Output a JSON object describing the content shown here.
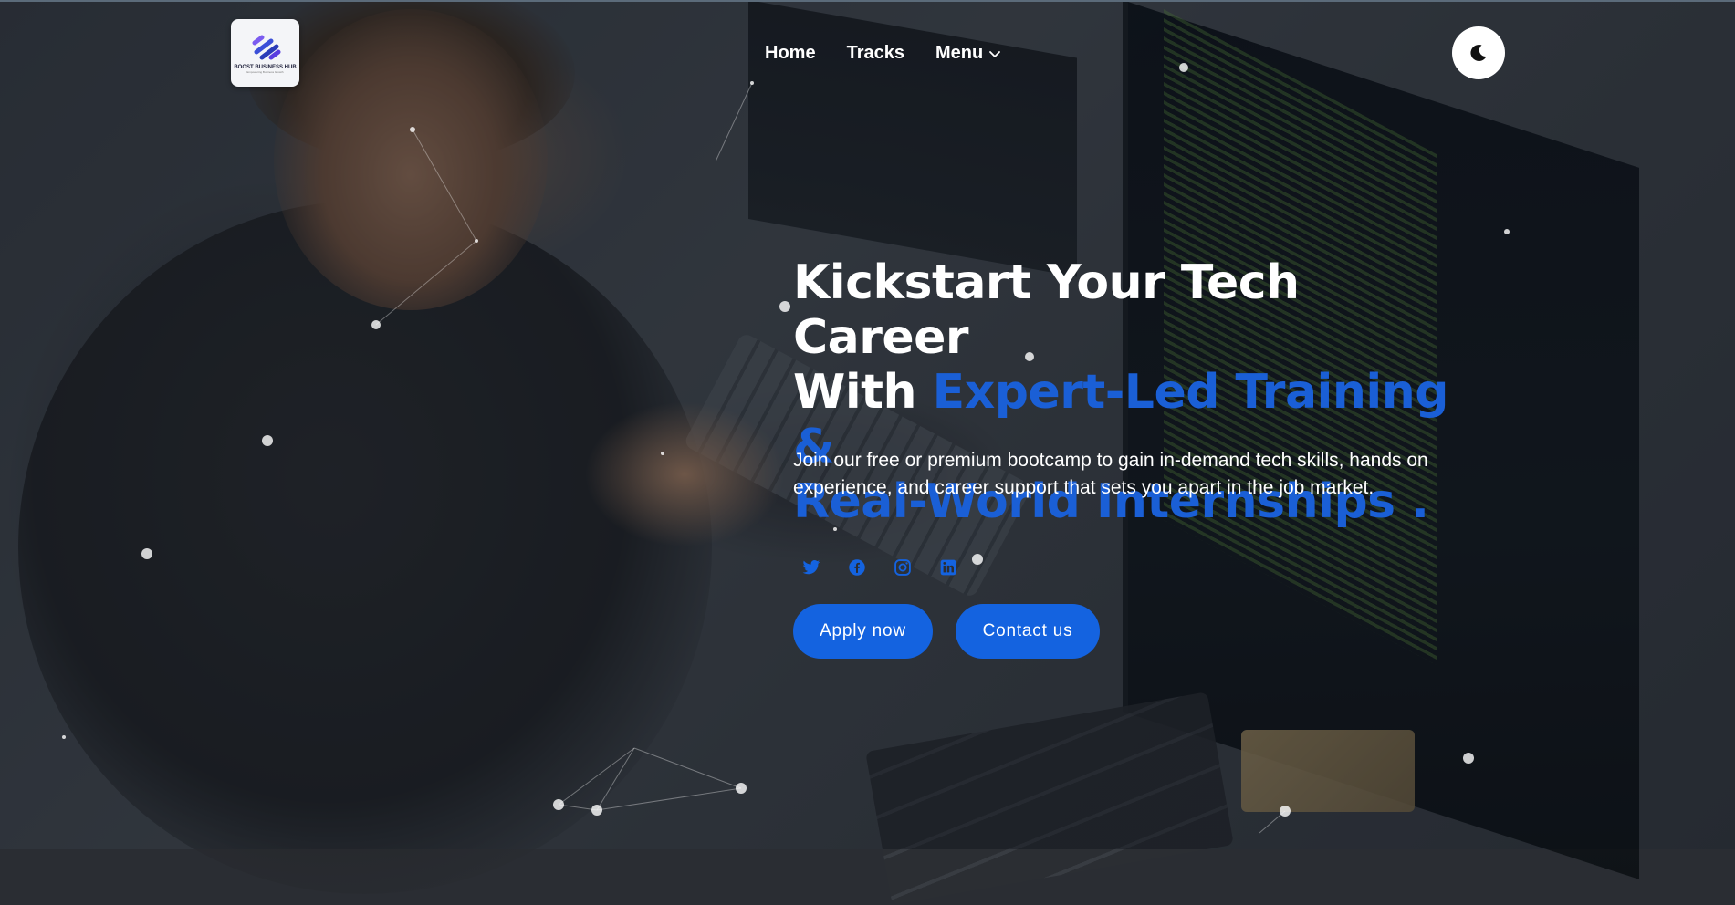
{
  "header": {
    "logo": {
      "name": "BOOST BUSINESS HUB",
      "tagline": "Empowering Business Growth"
    },
    "nav": [
      {
        "label": "Home"
      },
      {
        "label": "Tracks"
      },
      {
        "label": "Menu",
        "icon": "chevron-down-icon"
      }
    ],
    "theme_toggle": {
      "icon": "moon-icon"
    }
  },
  "hero": {
    "title_line1": "Kickstart Your Tech Career",
    "title_line2_prefix": "With ",
    "title_highlight_1": "Expert-Led Training &",
    "title_highlight_2": "Real-World Internships .",
    "description": "Join our free or premium bootcamp to gain in-demand tech skills, hands on experience, and career support that sets you apart in the job market.",
    "socials": [
      "twitter-icon",
      "facebook-icon",
      "instagram-icon",
      "linkedin-icon"
    ],
    "buttons": {
      "apply": "Apply now",
      "contact": "Contact us"
    }
  },
  "colors": {
    "accent": "#1a5fd6",
    "button": "#1463e0",
    "text": "#ffffff"
  }
}
